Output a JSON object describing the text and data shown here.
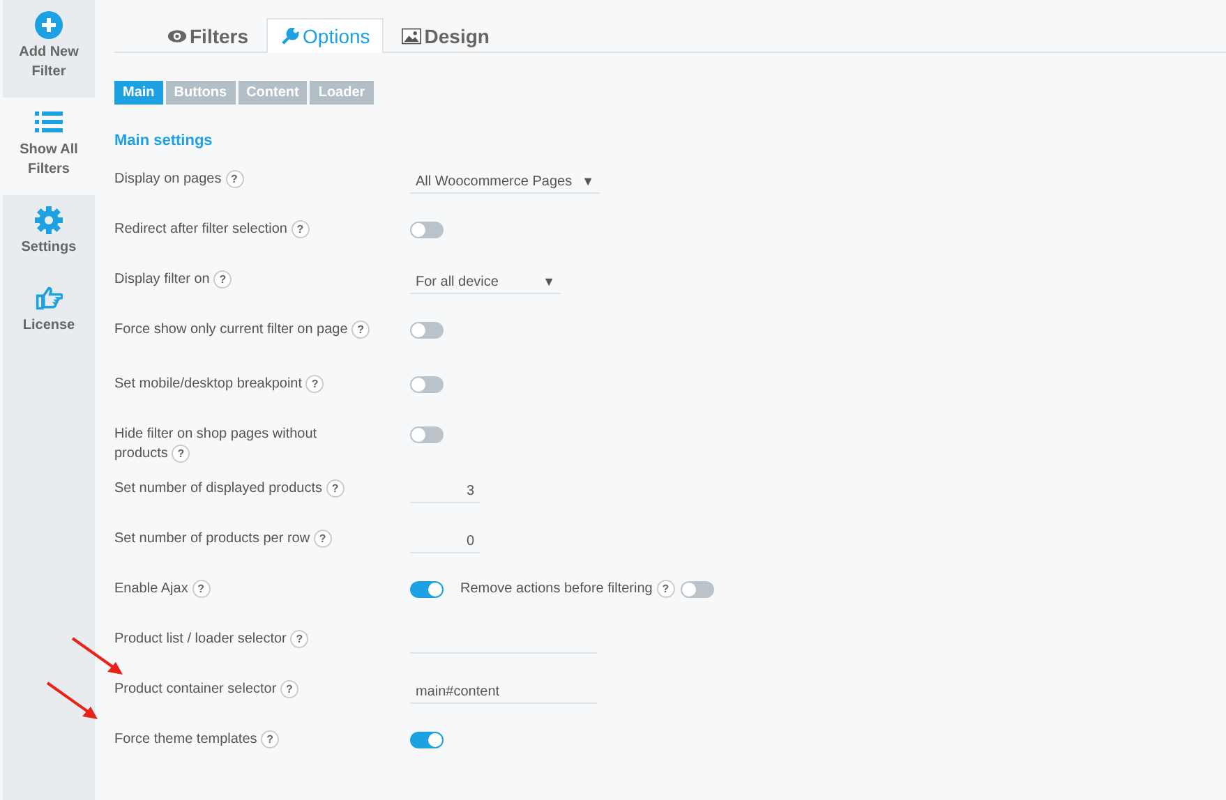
{
  "sidebar": {
    "items": [
      {
        "label": "Add New Filter",
        "kind": "plus",
        "selected": false
      },
      {
        "label": "Show All Filters",
        "kind": "list",
        "selected": true
      },
      {
        "label": "Settings",
        "kind": "gear",
        "selected": false
      },
      {
        "label": "License",
        "kind": "hand",
        "selected": false
      }
    ]
  },
  "tabs": [
    {
      "label": "Filters",
      "kind": "eye",
      "selected": false
    },
    {
      "label": "Options",
      "kind": "wrench",
      "selected": true
    },
    {
      "label": "Design",
      "kind": "image",
      "selected": false
    }
  ],
  "subtabs": [
    {
      "label": "Main",
      "selected": true
    },
    {
      "label": "Buttons",
      "selected": false
    },
    {
      "label": "Content",
      "selected": false
    },
    {
      "label": "Loader",
      "selected": false
    }
  ],
  "section_title": "Main settings",
  "help_mark": "?",
  "rows": [
    {
      "label": "Display on pages",
      "kind": "select",
      "value": "All Woocommerce Pages",
      "caret": "▼"
    },
    {
      "label": "Redirect after filter selection",
      "kind": "toggle",
      "on": false
    },
    {
      "label": "Display filter on",
      "kind": "select",
      "value": "For all device",
      "caret": "▼"
    },
    {
      "label": "Force show only current filter on page",
      "kind": "toggle",
      "on": false
    },
    {
      "label": "Set mobile/desktop breakpoint",
      "kind": "toggle",
      "on": false
    },
    {
      "label": "Hide filter on shop pages without products",
      "kind": "toggle",
      "on": false
    },
    {
      "label": "Set number of displayed products",
      "kind": "number",
      "value": "3"
    },
    {
      "label": "Set number of products per row",
      "kind": "number",
      "value": "0"
    },
    {
      "label": "Enable Ajax",
      "kind": "toggle",
      "on": true,
      "extra": {
        "label": "Remove actions before filtering",
        "on": false
      }
    },
    {
      "label": "Product list / loader selector",
      "kind": "text",
      "value": ""
    },
    {
      "label": "Product container selector",
      "kind": "text",
      "value": "main#content"
    },
    {
      "label": "Force theme templates",
      "kind": "toggle",
      "on": true
    }
  ]
}
